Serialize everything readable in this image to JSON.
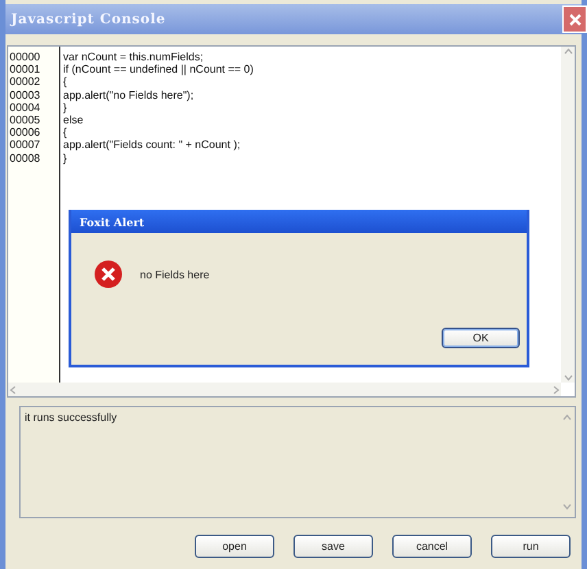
{
  "window": {
    "title": "Javascript Console"
  },
  "editor": {
    "lines": [
      {
        "number": "00000",
        "code": "var nCount = this.numFields;"
      },
      {
        "number": "00001",
        "code": "if (nCount == undefined || nCount == 0)"
      },
      {
        "number": "00002",
        "code": "{"
      },
      {
        "number": "00003",
        "code": "app.alert(\"no Fields here\");"
      },
      {
        "number": "00004",
        "code": "}"
      },
      {
        "number": "00005",
        "code": "else"
      },
      {
        "number": "00006",
        "code": "{"
      },
      {
        "number": "00007",
        "code": "app.alert(\"Fields count: \" + nCount );"
      },
      {
        "number": "00008",
        "code": "}"
      }
    ]
  },
  "alert": {
    "title": "Foxit Alert",
    "message": "no Fields here",
    "button": "OK"
  },
  "output": {
    "text": "it runs successfully"
  },
  "buttons": [
    "open",
    "save",
    "cancel",
    "run"
  ]
}
